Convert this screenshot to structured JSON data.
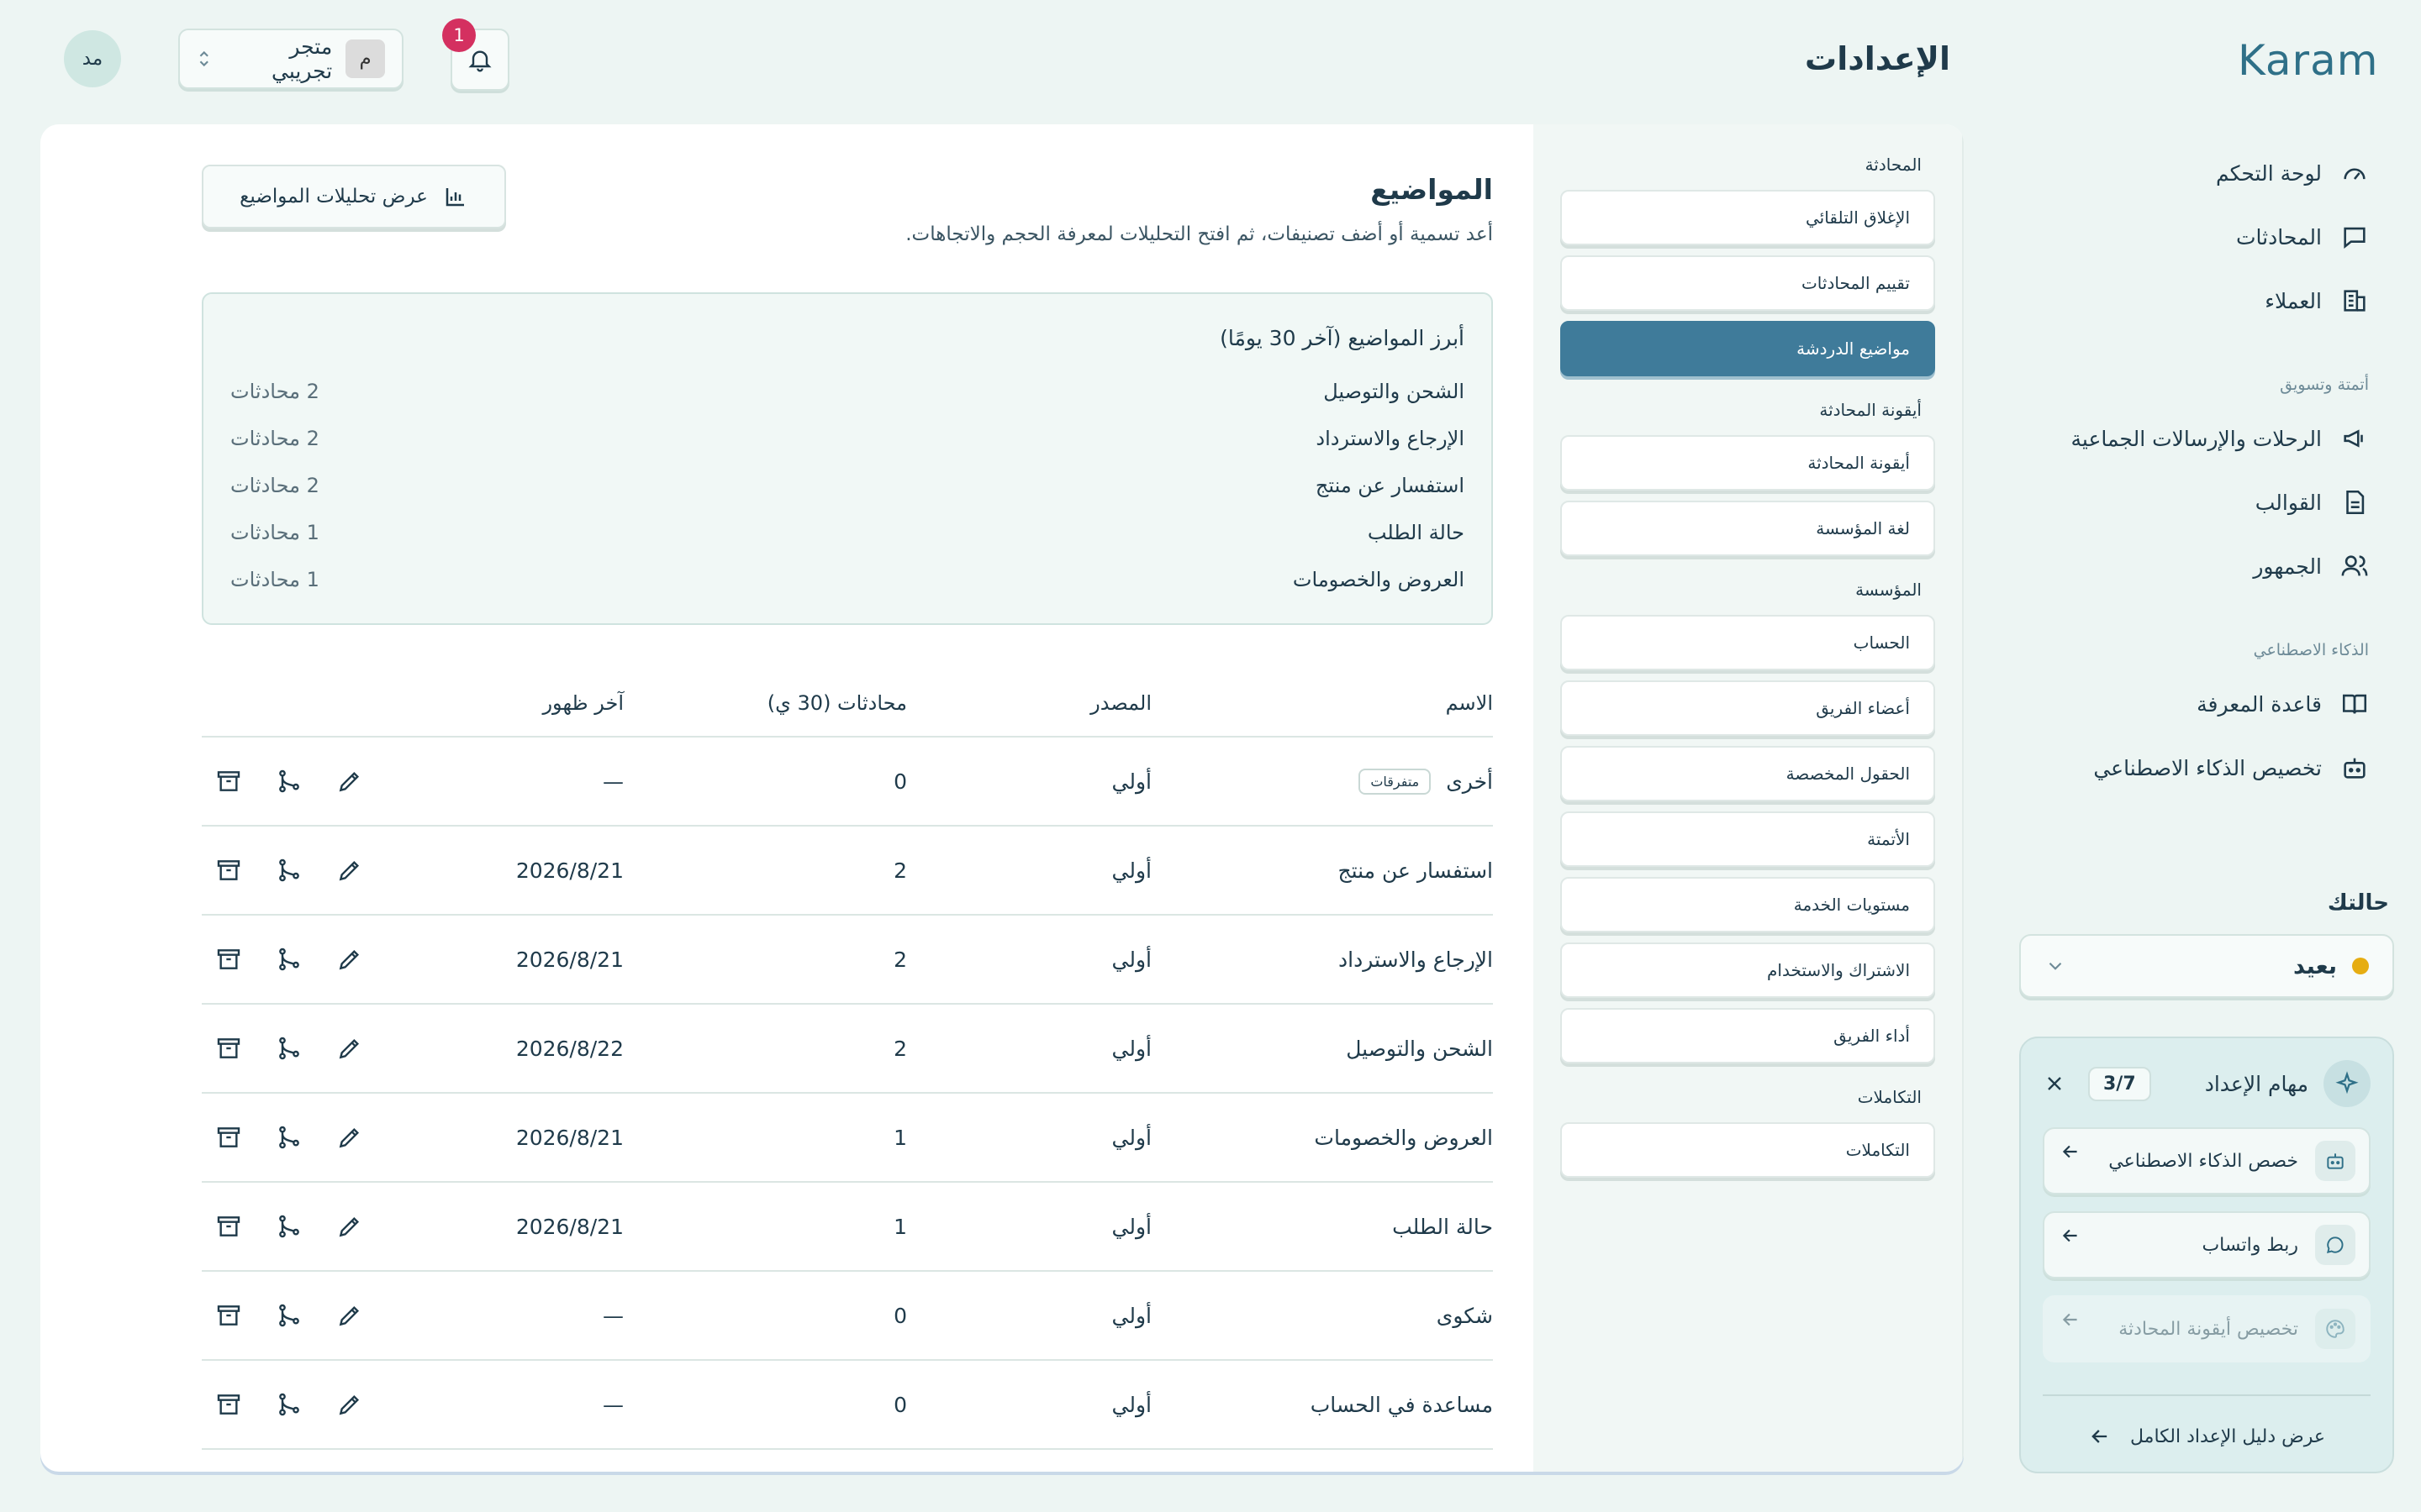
{
  "brand": {
    "logo": "Karam"
  },
  "nav": {
    "items": [
      {
        "label": "لوحة التحكم",
        "icon": "gauge-icon"
      },
      {
        "label": "المحادثات",
        "icon": "chat-icon"
      },
      {
        "label": "العملاء",
        "icon": "building-icon"
      }
    ],
    "group_automation": "أتمتة وتسويق",
    "automation_items": [
      {
        "label": "الرحلات والإرسالات الجماعية",
        "icon": "megaphone-icon"
      },
      {
        "label": "القوالب",
        "icon": "document-icon"
      },
      {
        "label": "الجمهور",
        "icon": "users-icon"
      }
    ],
    "group_ai": "الذكاء الاصطناعي",
    "ai_items": [
      {
        "label": "قاعدة المعرفة",
        "icon": "book-icon"
      },
      {
        "label": "تخصيص الذكاء الاصطناعي",
        "icon": "bot-icon"
      }
    ]
  },
  "status": {
    "label": "حالتك",
    "value": "بعيد",
    "dot_color": "#e6ad12"
  },
  "onboarding": {
    "title": "مهام الإعداد",
    "count": "3/7",
    "tasks": [
      {
        "label": "خصص الذكاء الاصطناعي",
        "icon": "bot-icon",
        "done": false
      },
      {
        "label": "ربط واتساب",
        "icon": "chat-bubble-icon",
        "done": false
      },
      {
        "label": "تخصيص أيقونة المحادثة",
        "icon": "palette-icon",
        "done": true
      }
    ],
    "guide_link": "عرض دليل الإعداد الكامل"
  },
  "header": {
    "title": "الإعدادات",
    "notification_count": "1",
    "store_name": "متجر تجريبي",
    "store_initial": "م",
    "user_initials": "مد"
  },
  "settings_nav": {
    "groups": [
      {
        "title": "المحادثة",
        "items": [
          "الإغلاق التلقائي",
          "تقييم المحادثات",
          "مواضيع الدردشة"
        ]
      },
      {
        "title": "أيقونة المحادثة",
        "items": [
          "أيقونة المحادثة",
          "لغة المؤسسة"
        ]
      },
      {
        "title": "المؤسسة",
        "items": [
          "الحساب",
          "أعضاء الفريق",
          "الحقول المخصصة",
          "الأتمتة",
          "مستويات الخدمة",
          "الاشتراك والاستخدام",
          "أداء الفريق"
        ]
      },
      {
        "title": "التكاملات",
        "items": [
          "التكاملات"
        ]
      }
    ],
    "active": "مواضيع الدردشة"
  },
  "topics": {
    "title": "المواضيع",
    "subtitle": "أعد تسمية أو أضف تصنيفات، ثم افتح التحليلات لمعرفة الحجم والاتجاهات.",
    "analytics_button": "عرض تحليلات المواضيع",
    "top_title": "أبرز المواضيع (آخر 30 يومًا)",
    "top": [
      {
        "name": "الشحن والتوصيل",
        "count": "2 محادثات"
      },
      {
        "name": "الإرجاع والاسترداد",
        "count": "2 محادثات"
      },
      {
        "name": "استفسار عن منتج",
        "count": "2 محادثات"
      },
      {
        "name": "حالة الطلب",
        "count": "1 محادثات"
      },
      {
        "name": "العروض والخصومات",
        "count": "1 محادثات"
      }
    ],
    "columns": {
      "name": "الاسم",
      "source": "المصدر",
      "conversations": "محادثات (30 ي)",
      "last_seen": "آخر ظهور"
    },
    "rows": [
      {
        "name": "أخرى",
        "tag": "متفرقات",
        "source": "أولي",
        "conversations": "0",
        "last_seen": "—"
      },
      {
        "name": "استفسار عن منتج",
        "tag": "",
        "source": "أولي",
        "conversations": "2",
        "last_seen": "2026/8/21"
      },
      {
        "name": "الإرجاع والاسترداد",
        "tag": "",
        "source": "أولي",
        "conversations": "2",
        "last_seen": "2026/8/21"
      },
      {
        "name": "الشحن والتوصيل",
        "tag": "",
        "source": "أولي",
        "conversations": "2",
        "last_seen": "2026/8/22"
      },
      {
        "name": "العروض والخصومات",
        "tag": "",
        "source": "أولي",
        "conversations": "1",
        "last_seen": "2026/8/21"
      },
      {
        "name": "حالة الطلب",
        "tag": "",
        "source": "أولي",
        "conversations": "1",
        "last_seen": "2026/8/21"
      },
      {
        "name": "شكوى",
        "tag": "",
        "source": "أولي",
        "conversations": "0",
        "last_seen": "—"
      },
      {
        "name": "مساعدة في الحساب",
        "tag": "",
        "source": "أولي",
        "conversations": "0",
        "last_seen": "—"
      }
    ]
  },
  "colors": {
    "accent": "#3f7b9a",
    "badge": "#d43060",
    "background": "#edf5f3"
  }
}
